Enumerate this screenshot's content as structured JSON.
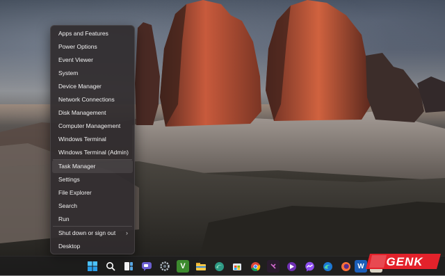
{
  "menu": {
    "items": [
      {
        "label": "Apps and Features"
      },
      {
        "label": "Power Options"
      },
      {
        "label": "Event Viewer"
      },
      {
        "label": "System"
      },
      {
        "label": "Device Manager"
      },
      {
        "label": "Network Connections"
      },
      {
        "label": "Disk Management"
      },
      {
        "label": "Computer Management"
      },
      {
        "label": "Windows Terminal"
      },
      {
        "label": "Windows Terminal (Admin)"
      },
      {
        "label": "Task Manager"
      },
      {
        "label": "Settings"
      },
      {
        "label": "File Explorer"
      },
      {
        "label": "Search"
      },
      {
        "label": "Run"
      },
      {
        "label": "Shut down or sign out"
      },
      {
        "label": "Desktop"
      }
    ],
    "submenu_icon": "chevron-right-icon",
    "chevron_glyph": "›",
    "hovered_item": "Task Manager"
  },
  "taskbar": {
    "icons": [
      {
        "name": "start-icon"
      },
      {
        "name": "search-icon"
      },
      {
        "name": "task-view-icon"
      },
      {
        "name": "chat-icon"
      },
      {
        "name": "settings-icon"
      },
      {
        "name": "vim-icon",
        "glyph": "V"
      },
      {
        "name": "file-explorer-icon"
      },
      {
        "name": "edge-dev-icon"
      },
      {
        "name": "microsoft-store-icon"
      },
      {
        "name": "chrome-icon"
      },
      {
        "name": "app-icon"
      },
      {
        "name": "media-app-icon"
      },
      {
        "name": "messenger-icon"
      },
      {
        "name": "edge-icon"
      },
      {
        "name": "firefox-icon"
      },
      {
        "name": "word-icon",
        "glyph": "W"
      },
      {
        "name": "media-player-icon"
      }
    ]
  },
  "watermark": {
    "text": "GENK"
  },
  "colors": {
    "menu_bg": "#302c2e",
    "menu_text": "#f1f1f1",
    "watermark_red": "#e3222b",
    "rock_glow": "#c85a3c"
  }
}
